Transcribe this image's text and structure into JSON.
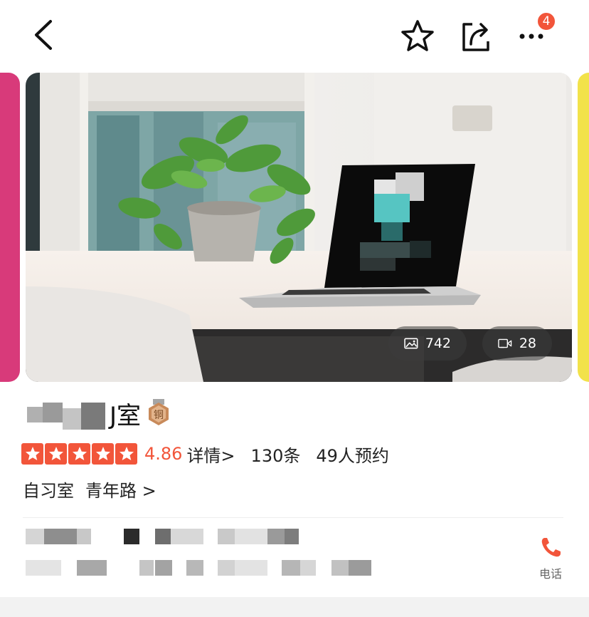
{
  "header": {
    "notification_count": "4",
    "icons": [
      "back-arrow-icon",
      "star-outline-icon",
      "share-icon",
      "more-dots-icon"
    ]
  },
  "gallery": {
    "photo_count": "742",
    "video_count": "28"
  },
  "venue": {
    "name_visible": "J室",
    "medal_label": "铜",
    "rating": "4.86",
    "details_link": "详情>",
    "review_count": "130条",
    "booked_count": "49人预约",
    "category": "自习室",
    "location": "青年路 >",
    "phone_label": "电话"
  },
  "colors": {
    "accent": "#f2553a",
    "medal": "#c88a5a"
  }
}
